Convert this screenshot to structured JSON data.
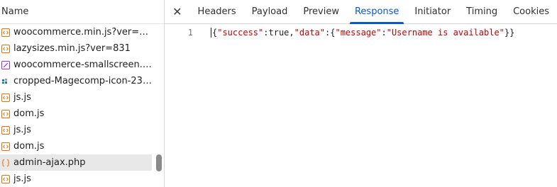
{
  "left_pane": {
    "header": "Name",
    "files": [
      {
        "name": "woocommerce.min.js?ver=10....",
        "icon": "js-icon",
        "color": "#e8710a"
      },
      {
        "name": "lazysizes.min.js?ver=831",
        "icon": "js-icon",
        "color": "#e8710a"
      },
      {
        "name": "woocommerce-smallscreen.cs...",
        "icon": "css-icon",
        "color": "#9334e6"
      },
      {
        "name": "cropped-Magecomp-icon-231...",
        "icon": "image-icon",
        "color": "#1a73e8"
      },
      {
        "name": "js.js",
        "icon": "js-icon",
        "color": "#e8710a"
      },
      {
        "name": "dom.js",
        "icon": "js-icon",
        "color": "#e8710a"
      },
      {
        "name": "js.js",
        "icon": "js-icon",
        "color": "#e8710a"
      },
      {
        "name": "dom.js",
        "icon": "js-icon",
        "color": "#e8710a"
      },
      {
        "name": "admin-ajax.php",
        "icon": "xhr-icon",
        "color": "#e8710a",
        "selected": true
      },
      {
        "name": "js.js",
        "icon": "js-icon",
        "color": "#e8710a"
      }
    ]
  },
  "tabs": [
    "Headers",
    "Payload",
    "Preview",
    "Response",
    "Initiator",
    "Timing",
    "Cookies"
  ],
  "active_tab": "Response",
  "close_icon": "close-icon",
  "response": {
    "line_number": "1",
    "tokens": [
      {
        "t": "{",
        "c": "punct"
      },
      {
        "t": "\"success\"",
        "c": "key"
      },
      {
        "t": ":",
        "c": "punct"
      },
      {
        "t": "true",
        "c": "kw"
      },
      {
        "t": ",",
        "c": "punct"
      },
      {
        "t": "\"data\"",
        "c": "key"
      },
      {
        "t": ":",
        "c": "punct"
      },
      {
        "t": "{",
        "c": "punct"
      },
      {
        "t": "\"message\"",
        "c": "key"
      },
      {
        "t": ":",
        "c": "punct"
      },
      {
        "t": "\"Username is available\"",
        "c": "str"
      },
      {
        "t": "}}",
        "c": "punct"
      }
    ]
  }
}
